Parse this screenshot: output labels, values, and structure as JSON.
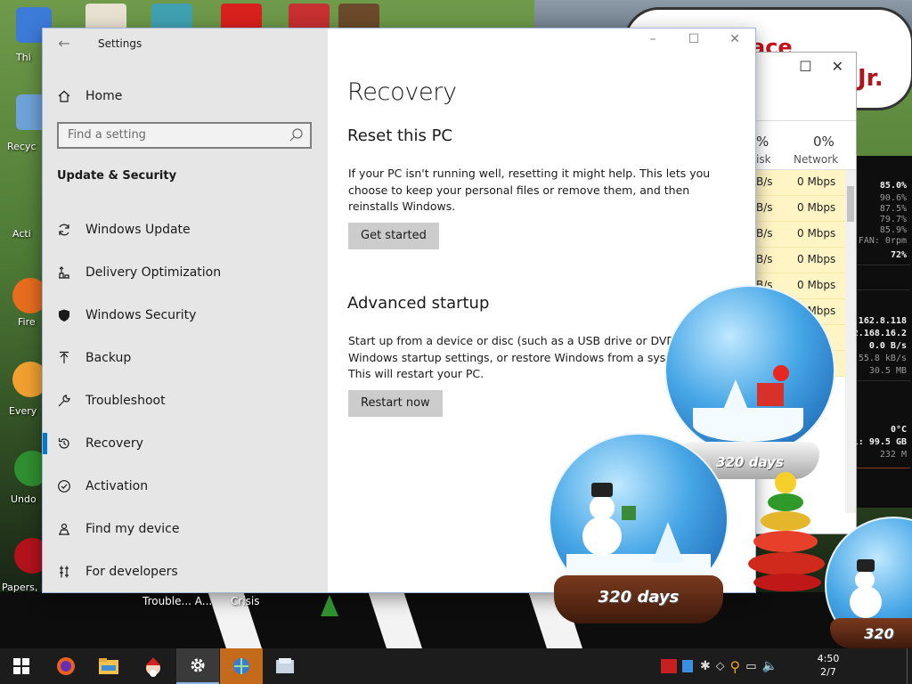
{
  "wallpaper": {
    "sign_text_1": "ace",
    "sign_text_2": "Jr.",
    "monitor_lines": [
      "85.0%",
      "90.6%",
      "87.5%",
      "79.7%",
      "85.9%",
      "FAN: 0rpm",
      "72%",
      ".162.8.118",
      "2.168.16.2",
      "0.0 B/s",
      "55.8 kB/s",
      "30.5 MB",
      "0°C",
      "al: 99.5 GB",
      "232 M"
    ]
  },
  "desktop_icons": [
    {
      "label": "Thi",
      "color": "#3d7bd9"
    },
    {
      "label": "Recyc",
      "color": "#6ea3d8"
    },
    {
      "label": "Acti",
      "color": "#4e7f3d"
    },
    {
      "label": "Fire",
      "color": "#e66d1d"
    },
    {
      "label": "Every",
      "color": "#f0a030"
    },
    {
      "label": "Undo",
      "color": "#2f8f2f"
    },
    {
      "label": "Papers, P",
      "color": "#b3121b"
    }
  ],
  "desktop_labels": [
    "Trouble... A...",
    "Crisis"
  ],
  "task_manager": {
    "cpu_pct": "%",
    "network_pct": "0%",
    "col1": "isk",
    "col2": "Network",
    "rows": [
      {
        "disk": "B/s",
        "net": "0 Mbps"
      },
      {
        "disk": "B/s",
        "net": "0 Mbps"
      },
      {
        "disk": "B/s",
        "net": "0 Mbps"
      },
      {
        "disk": "B/s",
        "net": "0 Mbps"
      },
      {
        "disk": "B/s",
        "net": "0 Mbps"
      },
      {
        "disk": "",
        "net": "0 Mbps"
      },
      {
        "disk": "",
        "net": ""
      },
      {
        "disk": "",
        "net": ""
      }
    ]
  },
  "settings": {
    "window_title": "Settings",
    "home_label": "Home",
    "search_placeholder": "Find a setting",
    "section_title": "Update & Security",
    "nav_items": [
      {
        "label": "Windows Update",
        "icon": "sync-icon"
      },
      {
        "label": "Delivery Optimization",
        "icon": "delivery-icon"
      },
      {
        "label": "Windows Security",
        "icon": "shield-icon"
      },
      {
        "label": "Backup",
        "icon": "backup-icon"
      },
      {
        "label": "Troubleshoot",
        "icon": "wrench-icon"
      },
      {
        "label": "Recovery",
        "icon": "recovery-icon",
        "selected": true
      },
      {
        "label": "Activation",
        "icon": "check-circle-icon"
      },
      {
        "label": "Find my device",
        "icon": "person-location-icon"
      },
      {
        "label": "For developers",
        "icon": "developer-icon"
      }
    ],
    "page_title": "Recovery",
    "reset": {
      "heading": "Reset this PC",
      "description": "If your PC isn't running well, resetting it might help. This lets you choose to keep your personal files or remove them, and then reinstalls Windows.",
      "button": "Get started"
    },
    "advanced": {
      "heading": "Advanced startup",
      "description_lines": [
        "Start up from a device or disc (such as a USB drive or DVD)",
        "Windows startup settings, or restore Windows from a syst",
        "This will restart your PC."
      ],
      "button": "Restart now"
    }
  },
  "gadgets": {
    "globe_labels": [
      "320 days",
      "320 days",
      "320"
    ]
  },
  "taskbar": {
    "apps": [
      "windows-start-icon",
      "firefox-icon",
      "file-explorer-icon",
      "santa-app-icon",
      "settings-gear-icon",
      "network-app-icon",
      "folder-app-icon"
    ],
    "clock_time": "4:50",
    "clock_date": "2/7"
  },
  "colors": {
    "accent": "#0078d7",
    "nav_bg": "#e6e6e6",
    "button_bg": "#cccccc",
    "taskbar_bg": "#1c1c1c",
    "taskmgr_highlight": "#fff4c4"
  }
}
